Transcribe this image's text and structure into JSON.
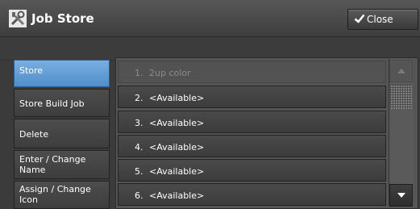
{
  "window": {
    "title": "Job Store",
    "close_label": "Close"
  },
  "menu": {
    "items": [
      {
        "label": "Store",
        "active": true
      },
      {
        "label": "Store Build Job",
        "active": false
      },
      {
        "label": "Delete",
        "active": false
      },
      {
        "label": "Enter / Change Name",
        "active": false
      },
      {
        "label": "Assign / Change Icon",
        "active": false
      }
    ]
  },
  "list": {
    "rows": [
      {
        "number": "1.",
        "text": "2up color",
        "enabled": false
      },
      {
        "number": "2.",
        "text": "<Available>",
        "enabled": true
      },
      {
        "number": "3.",
        "text": "<Available>",
        "enabled": true
      },
      {
        "number": "4.",
        "text": "<Available>",
        "enabled": true
      },
      {
        "number": "5.",
        "text": "<Available>",
        "enabled": true
      },
      {
        "number": "6.",
        "text": "<Available>",
        "enabled": true
      }
    ]
  },
  "colors": {
    "accent": "#5f9ad3",
    "background": "#3b3b3b"
  },
  "icons": {
    "app": "tools-icon",
    "close": "check-icon",
    "up": "arrow-up-icon",
    "down": "arrow-down-icon"
  }
}
